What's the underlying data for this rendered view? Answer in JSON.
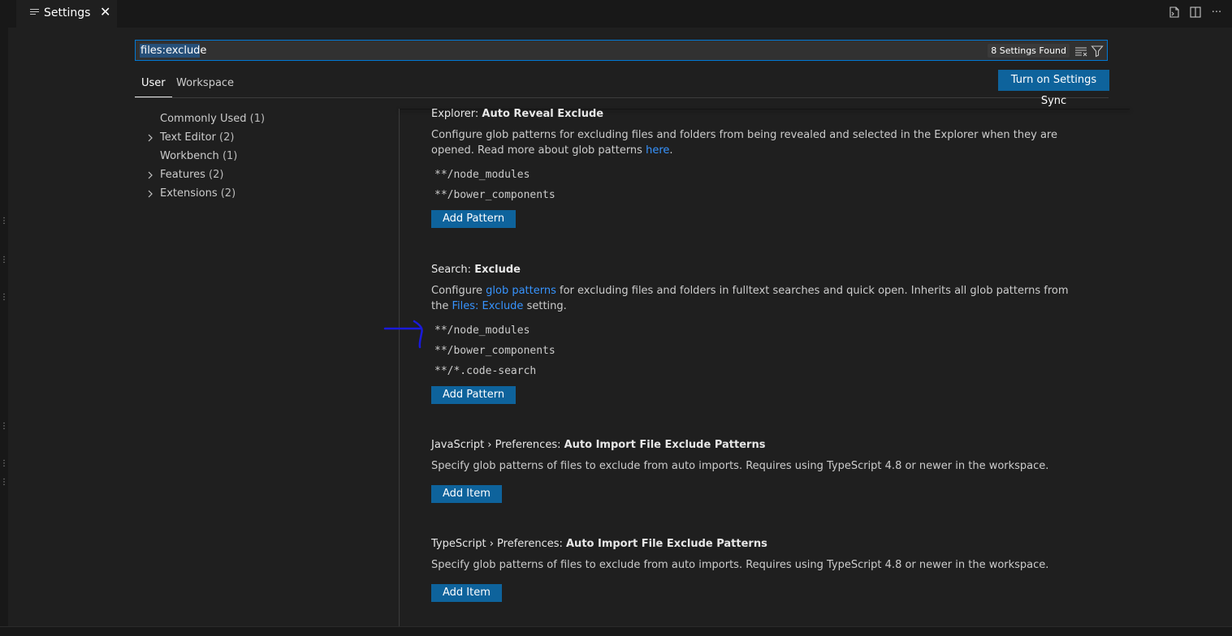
{
  "tab": {
    "title": "Settings",
    "close_glyph": "✕",
    "icon": "settings-file-icon"
  },
  "tab_actions": [
    {
      "name": "open-settings-json-icon",
      "label": "Open Settings (JSON)"
    },
    {
      "name": "split-editor-icon",
      "label": "Split Editor"
    },
    {
      "name": "more-actions-icon",
      "label": "···"
    }
  ],
  "search": {
    "value": "files:exclude",
    "found_badge": "8 Settings Found"
  },
  "scope_tabs": [
    "User",
    "Workspace"
  ],
  "sync_button": "Turn on Settings Sync",
  "toc": [
    {
      "label": "Commonly Used",
      "count": "(1)",
      "expandable": false
    },
    {
      "label": "Text Editor",
      "count": "(2)",
      "expandable": true
    },
    {
      "label": "Workbench",
      "count": "(1)",
      "expandable": false
    },
    {
      "label": "Features",
      "count": "(2)",
      "expandable": true
    },
    {
      "label": "Extensions",
      "count": "(2)",
      "expandable": true
    }
  ],
  "settings": {
    "explorer": {
      "category": "Explorer: ",
      "key": "Auto Reveal Exclude",
      "desc_part1": "Configure glob patterns for excluding files and folders from being revealed and selected in the Explorer when they are opened. Read more about glob patterns ",
      "desc_link": "here",
      "desc_part2": ".",
      "patterns": [
        "**/node_modules",
        "**/bower_components"
      ],
      "button": "Add Pattern"
    },
    "search": {
      "category": "Search: ",
      "key": "Exclude",
      "desc_part1": "Configure ",
      "desc_link1": "glob patterns",
      "desc_part2": " for excluding files and folders in fulltext searches and quick open. Inherits all glob patterns from the ",
      "desc_link2": "Files: Exclude",
      "desc_part3": " setting.",
      "patterns": [
        "**/node_modules",
        "**/bower_components",
        "**/*.code-search"
      ],
      "button": "Add Pattern"
    },
    "javascript": {
      "category": "JavaScript › Preferences: ",
      "key": "Auto Import File Exclude Patterns",
      "desc": "Specify glob patterns of files to exclude from auto imports. Requires using TypeScript 4.8 or newer in the workspace.",
      "button": "Add Item"
    },
    "typescript": {
      "category": "TypeScript › Preferences: ",
      "key": "Auto Import File Exclude Patterns",
      "desc": "Specify glob patterns of files to exclude from auto imports. Requires using TypeScript 4.8 or newer in the workspace.",
      "button": "Add Item"
    }
  },
  "colors": {
    "accent": "#0078d4",
    "button": "#0e639c",
    "link": "#3794ff",
    "annotation": "#1a1adb"
  }
}
